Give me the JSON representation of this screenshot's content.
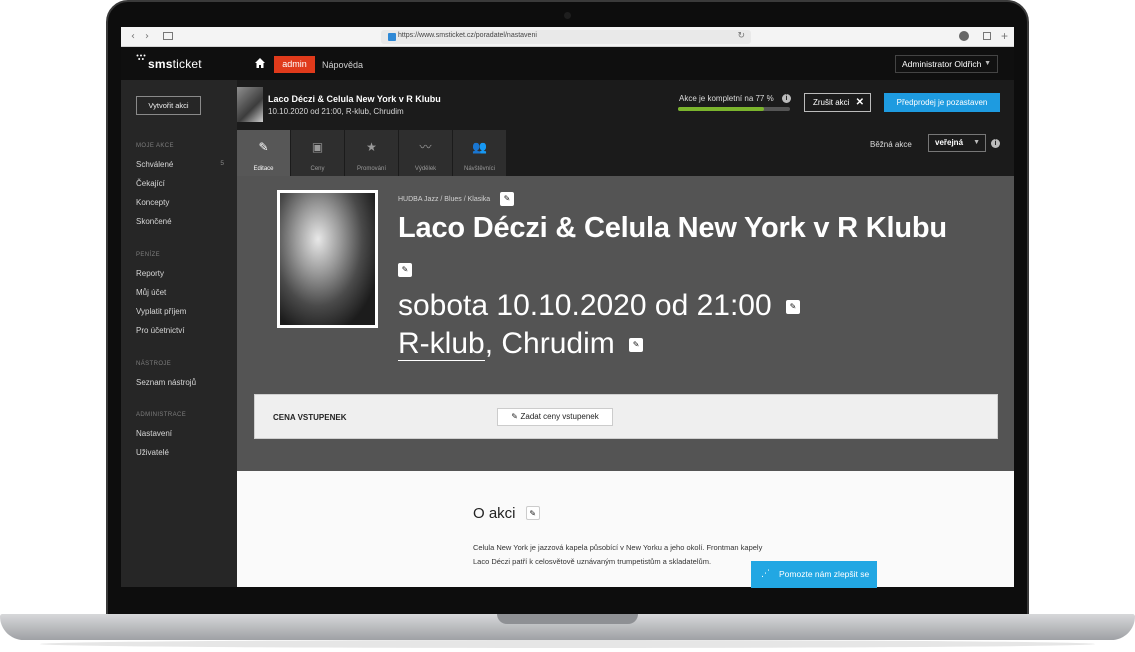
{
  "browser": {
    "url": "https://www.smsticket.cz/poradatel/nastaveni"
  },
  "topnav": {
    "logo_prefix": "sms",
    "logo_suffix": "ticket",
    "admin_label": "admin",
    "help_label": "Nápověda",
    "user_label": "Administrator Oldřich"
  },
  "sidebar": {
    "create_label": "Vytvořit akci",
    "sections": [
      {
        "title": "MOJE AKCE",
        "items": [
          {
            "label": "Schválené",
            "count": "5"
          },
          {
            "label": "Čekající"
          },
          {
            "label": "Koncepty"
          },
          {
            "label": "Skončené"
          }
        ]
      },
      {
        "title": "PENÍZE",
        "items": [
          {
            "label": "Reporty"
          },
          {
            "label": "Můj účet"
          },
          {
            "label": "Vyplatit příjem"
          },
          {
            "label": "Pro účetnictví"
          }
        ]
      },
      {
        "title": "NÁSTROJE",
        "items": [
          {
            "label": "Seznam nástrojů"
          }
        ]
      },
      {
        "title": "ADMINISTRACE",
        "items": [
          {
            "label": "Nastavení"
          },
          {
            "label": "Uživatelé"
          }
        ]
      }
    ]
  },
  "event_header": {
    "title": "Laco Déczi & Celula New York v R Klubu",
    "subtitle": "10.10.2020 od 21:00, R-klub, Chrudim",
    "complete_text": "Akce je kompletní na 77 %",
    "complete_fraction": 0.77,
    "cancel_label": "Zrušit akci",
    "presale_label": "Předprodej je pozastaven"
  },
  "tabs": [
    {
      "label": "Editace",
      "icon": "pencil-icon",
      "glyph": "✎",
      "active": true
    },
    {
      "label": "Ceny",
      "icon": "wallet-icon",
      "glyph": "▣",
      "active": false
    },
    {
      "label": "Promování",
      "icon": "star-icon",
      "glyph": "★",
      "active": false
    },
    {
      "label": "Výdělek",
      "icon": "chart-line-icon",
      "glyph": "〰",
      "active": false
    },
    {
      "label": "Návštěvníci",
      "icon": "users-icon",
      "glyph": "👥",
      "active": false
    }
  ],
  "event_type": {
    "label": "Běžná akce",
    "value": "veřejná"
  },
  "event": {
    "genre": "HUDBA Jazz / Blues / Klasika",
    "title": "Laco Déczi & Celula New York v R Klubu",
    "date": "sobota 10.10.2020 od 21:00",
    "venue": "R-klub",
    "city": ", Chrudim"
  },
  "prices": {
    "label": "CENA VSTUPENEK",
    "button_label": "Zadat ceny vstupenek"
  },
  "about": {
    "title": "O akci",
    "text": "Celula New York je jazzová kapela působící v New Yorku a jeho okolí. Frontman kapely Laco Déczi patří k celosvětově uznávaným trumpetistům a skladatelům."
  },
  "help_button": {
    "label": "Pomozte nám zlepšit se"
  },
  "colors": {
    "accent_red": "#e03a1b",
    "accent_blue": "#1e9be0",
    "progress_green": "#7bb42d"
  }
}
